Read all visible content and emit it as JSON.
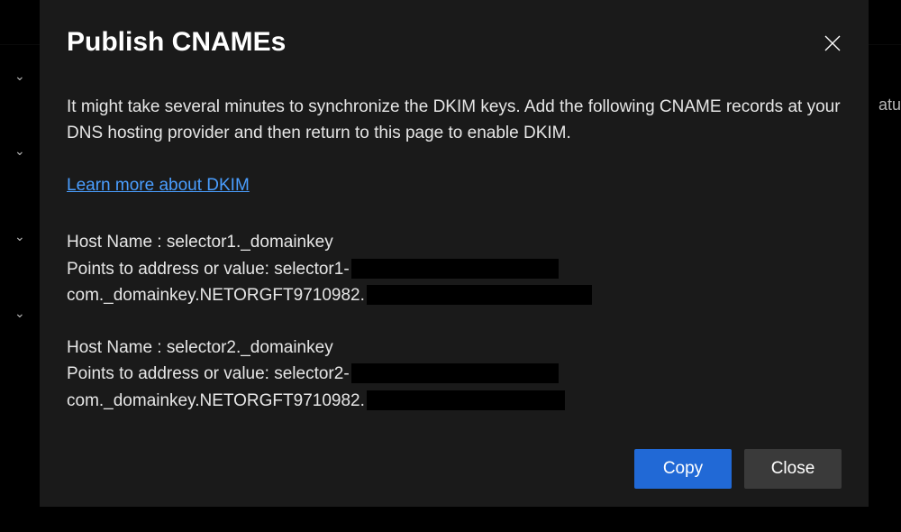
{
  "modal": {
    "title": "Publish CNAMEs",
    "description": "It might take several minutes to synchronize the DKIM keys. Add the following CNAME records at your DNS hosting provider and then return to this page to enable DKIM.",
    "learn_link": "Learn more about DKIM",
    "records": [
      {
        "host_label": "Host Name : selector1._domainkey",
        "points_prefix": "Points to address or value: selector1-",
        "points_line2": "com._domainkey.NETORGFT9710982."
      },
      {
        "host_label": "Host Name : selector2._domainkey",
        "points_prefix": "Points to address or value: selector2-",
        "points_line2": "com._domainkey.NETORGFT9710982."
      }
    ],
    "buttons": {
      "copy": "Copy",
      "close": "Close"
    }
  },
  "background": {
    "partial_text": "atu"
  }
}
